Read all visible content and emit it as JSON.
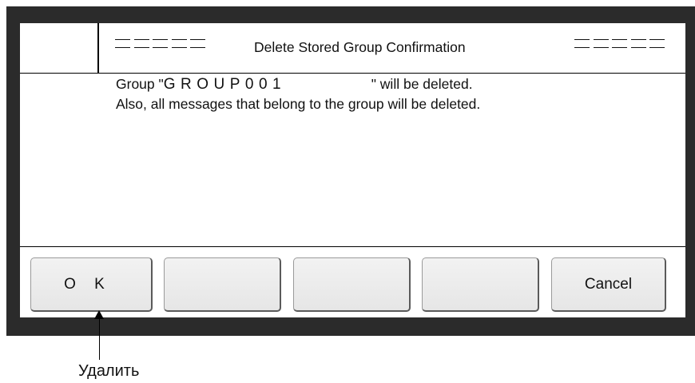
{
  "dialog": {
    "title": "Delete Stored Group Confirmation",
    "message_line1_prefix": "Group \"",
    "group_name": "GROUP001",
    "message_line1_suffix": "\" will be deleted.",
    "message_line2": "Also, all messages that belong to the group will be deleted."
  },
  "softkeys": {
    "ok_label": "O K",
    "key2_label": "",
    "key3_label": "",
    "key4_label": "",
    "cancel_label": "Cancel"
  },
  "annotation": {
    "label": "Удалить"
  },
  "colors": {
    "frame": "#2b2b2b",
    "screen_bg": "#ffffff",
    "button_bg": "#ececec"
  }
}
